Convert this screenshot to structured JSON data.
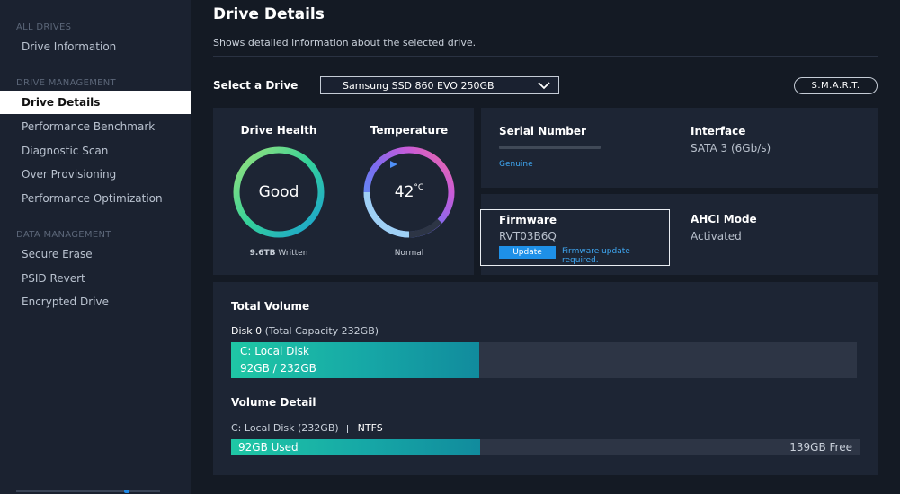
{
  "sidebar": {
    "sections": [
      {
        "title": "ALL DRIVES",
        "items": [
          "Drive Information"
        ]
      },
      {
        "title": "DRIVE MANAGEMENT",
        "items": [
          "Drive Details",
          "Performance Benchmark",
          "Diagnostic Scan",
          "Over Provisioning",
          "Performance Optimization"
        ]
      },
      {
        "title": "DATA MANAGEMENT",
        "items": [
          "Secure Erase",
          "PSID Revert",
          "Encrypted Drive"
        ]
      }
    ],
    "active": "Drive Details"
  },
  "header": {
    "title": "Drive Details",
    "subtitle": "Shows detailed information about the selected drive."
  },
  "select": {
    "label": "Select a Drive",
    "value": "Samsung SSD 860 EVO 250GB",
    "smart_button": "S.M.A.R.T."
  },
  "health": {
    "title": "Drive Health",
    "status": "Good",
    "written_value": "9.6TB",
    "written_label": "Written"
  },
  "temperature": {
    "title": "Temperature",
    "value": "42",
    "unit": "°C",
    "status": "Normal"
  },
  "info": {
    "serial_title": "Serial Number",
    "serial_badge": "Genuine",
    "interface_title": "Interface",
    "interface_value": "SATA 3 (6Gb/s)",
    "firmware_title": "Firmware",
    "firmware_value": "RVT03B6Q",
    "update_button": "Update",
    "firmware_note": "Firmware update required.",
    "ahci_title": "AHCI Mode",
    "ahci_value": "Activated"
  },
  "volume": {
    "total_title": "Total Volume",
    "disk_label": "Disk 0",
    "disk_capacity": "(Total Capacity 232GB)",
    "disk_bar_name": "C: Local Disk",
    "disk_bar_usage": "92GB / 232GB",
    "used_fraction": 0.3966,
    "detail_title": "Volume Detail",
    "detail_disk": "C: Local Disk (232GB)",
    "detail_fs": "NTFS",
    "used_label": "92GB Used",
    "free_label": "139GB Free"
  },
  "colors": {
    "accent_blue": "#1e90e8",
    "bar_teal": "#1fc7a5",
    "active_bg": "#ffffff"
  }
}
